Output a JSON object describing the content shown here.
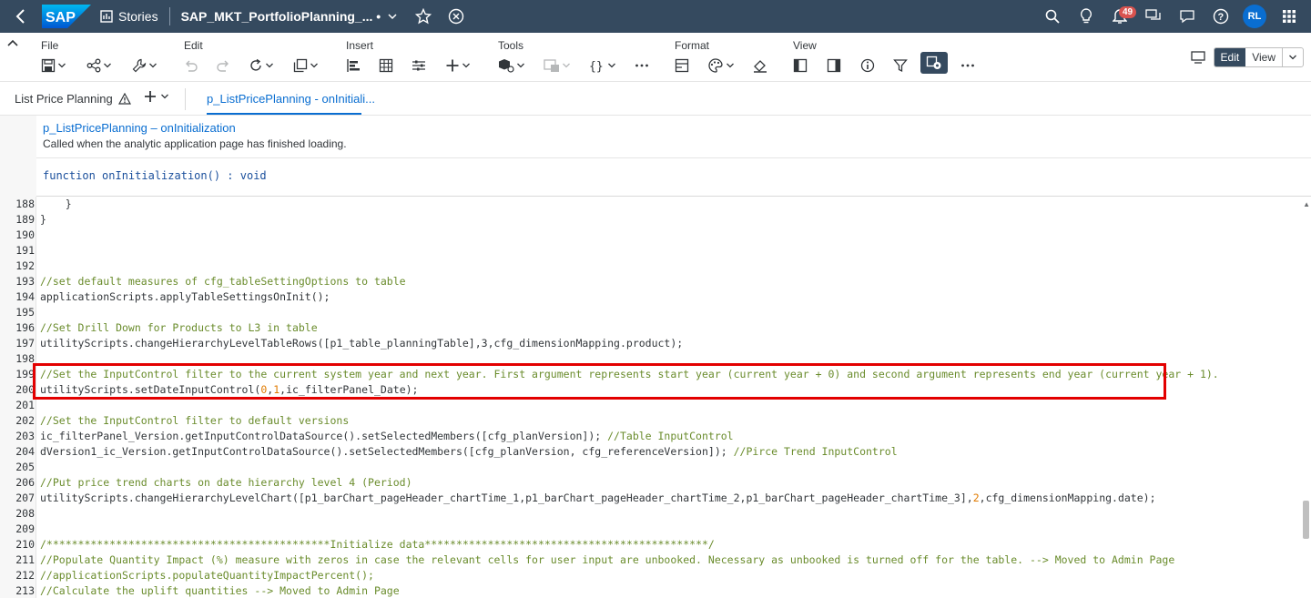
{
  "shell": {
    "logo": "SAP",
    "stories_label": "Stories",
    "doc_title": "SAP_MKT_PortfolioPlanning_... •",
    "notification_count": "49",
    "avatar_initials": "RL"
  },
  "toolbar": {
    "groups": {
      "file": "File",
      "edit": "Edit",
      "insert": "Insert",
      "tools": "Tools",
      "format": "Format",
      "view": "View"
    },
    "edit_mode": "Edit",
    "view_mode": "View"
  },
  "tabs": {
    "page_tab": "List Price Planning",
    "script_tab": "p_ListPricePlanning - onInitiali..."
  },
  "editor": {
    "function_title": "p_ListPricePlanning – onInitialization",
    "description": "Called when the analytic application page has finished loading.",
    "signature": "function onInitialization() : void"
  },
  "code_lines": [
    {
      "n": "188",
      "t": "    }",
      "type": "code"
    },
    {
      "n": "189",
      "t": "}",
      "type": "code"
    },
    {
      "n": "190",
      "t": "",
      "type": "code"
    },
    {
      "n": "191",
      "t": "",
      "type": "code"
    },
    {
      "n": "192",
      "t": "",
      "type": "code"
    },
    {
      "n": "193",
      "t": "//set default measures of cfg_tableSettingOptions to table",
      "type": "comment"
    },
    {
      "n": "194",
      "t": "applicationScripts.applyTableSettingsOnInit();",
      "type": "code"
    },
    {
      "n": "195",
      "t": "",
      "type": "code"
    },
    {
      "n": "196",
      "t": "//Set Drill Down for Products to L3 in table",
      "type": "comment"
    },
    {
      "n": "197",
      "t": "utilityScripts.changeHierarchyLevelTableRows([p1_table_planningTable],3,cfg_dimensionMapping.product);",
      "type": "code"
    },
    {
      "n": "198",
      "t": "",
      "type": "code"
    },
    {
      "n": "199",
      "t": "//Set the InputControl filter to the current system year and next year. First argument represents start year (current year + 0) and second argument represents end year (current year + 1).",
      "type": "comment"
    },
    {
      "n": "200",
      "pre": "utilityScripts.setDateInputControl(",
      "a": "0",
      "mid": ",",
      "b": "1",
      "post": ",ic_filterPanel_Date);",
      "type": "nums"
    },
    {
      "n": "201",
      "t": "",
      "type": "code"
    },
    {
      "n": "202",
      "t": "//Set the InputControl filter to default versions",
      "type": "comment"
    },
    {
      "n": "203",
      "t": "ic_filterPanel_Version.getInputControlDataSource().setSelectedMembers([cfg_planVersion]); ",
      "c": "//Table InputControl",
      "type": "mixed"
    },
    {
      "n": "204",
      "t": "dVersion1_ic_Version.getInputControlDataSource().setSelectedMembers([cfg_planVersion, cfg_referenceVersion]); ",
      "c": "//Pirce Trend InputControl",
      "type": "mixed"
    },
    {
      "n": "205",
      "t": "",
      "type": "code"
    },
    {
      "n": "206",
      "t": "//Put price trend charts on date hierarchy level 4 (Period)",
      "type": "comment"
    },
    {
      "n": "207",
      "pre": "utilityScripts.changeHierarchyLevelChart([p1_barChart_pageHeader_chartTime_1,p1_barChart_pageHeader_chartTime_2,p1_barChart_pageHeader_chartTime_3],",
      "a": "2",
      "mid": "",
      "b": "",
      "post": ",cfg_dimensionMapping.date);",
      "type": "nums"
    },
    {
      "n": "208",
      "t": "",
      "type": "code"
    },
    {
      "n": "209",
      "t": "",
      "type": "code"
    },
    {
      "n": "210",
      "t": "/*********************************************Initialize data*********************************************/",
      "type": "comment"
    },
    {
      "n": "211",
      "t": "//Populate Quantity Impact (%) measure with zeros in case the relevant cells for user input are unbooked. Necessary as unbooked is turned off for the table. --> Moved to Admin Page",
      "type": "comment"
    },
    {
      "n": "212",
      "t": "//applicationScripts.populateQuantityImpactPercent();",
      "type": "comment"
    },
    {
      "n": "213",
      "t": "//Calculate the uplift quantities --> Moved to Admin Page",
      "type": "comment"
    }
  ]
}
